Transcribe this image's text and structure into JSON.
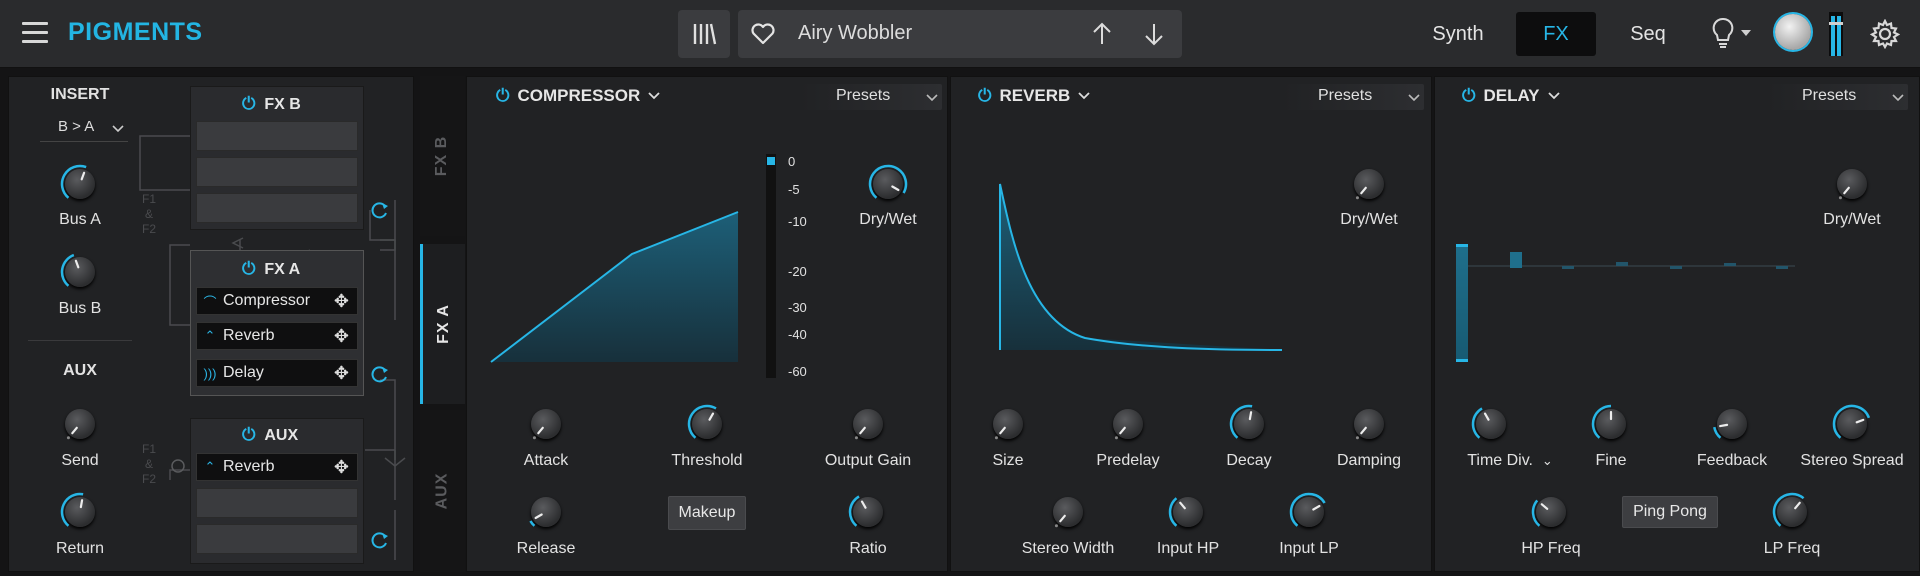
{
  "header": {
    "app_name": "PIGMENTS",
    "preset_name": "Airy Wobbler",
    "tabs": [
      {
        "label": "Synth",
        "active": false
      },
      {
        "label": "FX",
        "active": true
      },
      {
        "label": "Seq",
        "active": false
      }
    ],
    "accent_color": "#27b6e6"
  },
  "routing": {
    "insert_title": "INSERT",
    "insert_mode": "B > A",
    "bus_a_label": "Bus A",
    "bus_b_label": "Bus B",
    "aux_title": "AUX",
    "send_label": "Send",
    "return_label": "Return",
    "fxb": {
      "title": "FX B",
      "power_icon": "power-icon"
    },
    "fxa": {
      "title": "FX A",
      "items": [
        {
          "label": "Compressor",
          "icon": "compressor-curve-icon"
        },
        {
          "label": "Reverb",
          "icon": "reverb-icon"
        },
        {
          "label": "Delay",
          "icon": "delay-icon"
        }
      ]
    },
    "aux": {
      "title": "AUX",
      "items": [
        {
          "label": "Reverb",
          "icon": "reverb-icon"
        }
      ]
    },
    "f1f2_label_top": "F1 & F2",
    "f1f2_label_bottom": "F1 & F2"
  },
  "vertical_tabs": [
    {
      "label": "FX B",
      "active": false
    },
    {
      "label": "FX A",
      "active": true
    },
    {
      "label": "AUX",
      "active": false
    }
  ],
  "compressor": {
    "title": "COMPRESSOR",
    "presets_label": "Presets",
    "meter_labels": [
      "0",
      "-5",
      "-10",
      "-20",
      "-30",
      "-40",
      "-60"
    ],
    "drywet_label": "Dry/Wet",
    "attack_label": "Attack",
    "threshold_label": "Threshold",
    "output_gain_label": "Output Gain",
    "release_label": "Release",
    "makeup_label": "Makeup",
    "ratio_label": "Ratio"
  },
  "reverb": {
    "title": "REVERB",
    "presets_label": "Presets",
    "drywet_label": "Dry/Wet",
    "size_label": "Size",
    "predelay_label": "Predelay",
    "decay_label": "Decay",
    "damping_label": "Damping",
    "stereo_width_label": "Stereo Width",
    "input_hp_label": "Input HP",
    "input_lp_label": "Input LP"
  },
  "delay": {
    "title": "DELAY",
    "presets_label": "Presets",
    "drywet_label": "Dry/Wet",
    "time_div_label": "Time Div.",
    "fine_label": "Fine",
    "feedback_label": "Feedback",
    "stereo_spread_label": "Stereo Spread",
    "hp_freq_label": "HP Freq",
    "ping_pong_label": "Ping Pong",
    "lp_freq_label": "LP Freq"
  }
}
